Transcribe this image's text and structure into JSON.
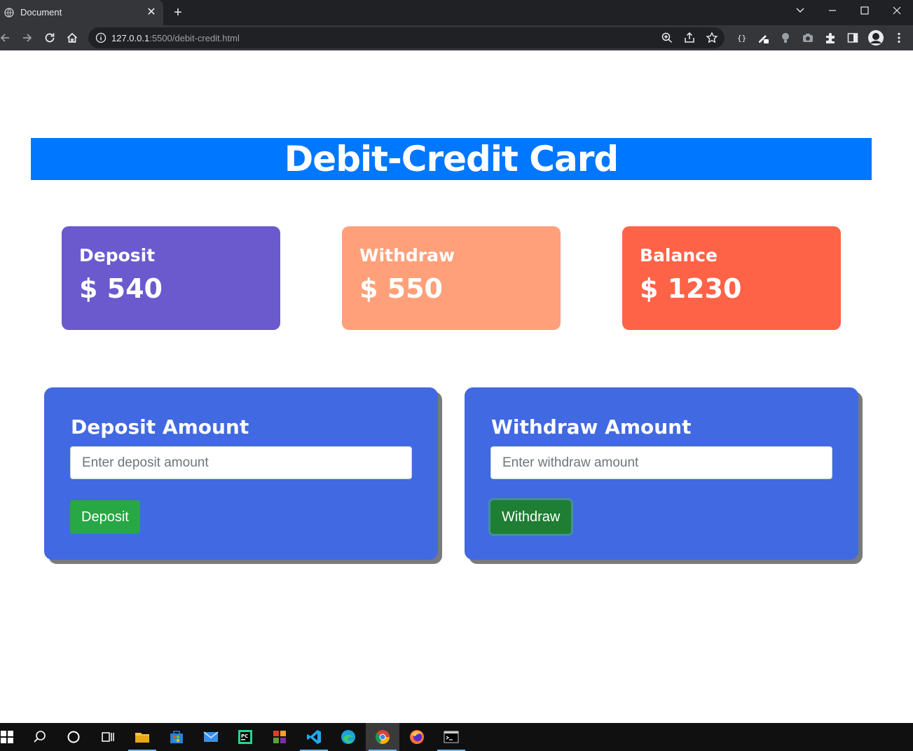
{
  "browser": {
    "tab_title": "Document",
    "url_host": "127.0.0.1",
    "url_rest": ":5500/debit-credit.html"
  },
  "page": {
    "title": "Debit-Credit Card",
    "cards": [
      {
        "label": "Deposit",
        "value": "$ 540",
        "color": "#6a5acd"
      },
      {
        "label": "Withdraw",
        "value": "$ 550",
        "color": "#ffa07a"
      },
      {
        "label": "Balance",
        "value": "$ 1230",
        "color": "#ff6347"
      }
    ],
    "deposit_form": {
      "title": "Deposit Amount",
      "placeholder": "Enter deposit amount",
      "button": "Deposit"
    },
    "withdraw_form": {
      "title": "Withdraw Amount",
      "placeholder": "Enter withdraw amount",
      "button": "Withdraw"
    }
  },
  "colors": {
    "banner": "#0077ff",
    "form_card": "#4169e1",
    "deposit_button": "#28a745",
    "withdraw_button": "#1e7e34"
  },
  "taskbar_icons": [
    "windows-start-icon",
    "search-icon",
    "cortana-icon",
    "task-view-icon",
    "file-explorer-icon",
    "store-icon",
    "mail-icon",
    "pycharm-icon",
    "app-icon",
    "vscode-icon",
    "edge-icon",
    "chrome-icon",
    "firefox-icon",
    "terminal-icon"
  ]
}
